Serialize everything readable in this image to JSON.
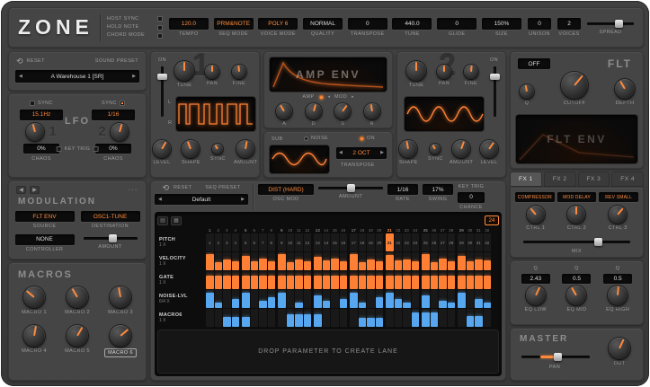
{
  "colors": {
    "accent": "#ff8a3c",
    "blue": "#56a7ef",
    "panel": "#454545",
    "display_bg": "#0c0c0c"
  },
  "header": {
    "logo": "ZONE",
    "toggles": [
      "HOST SYNC",
      "HOLD NOTE",
      "CHORD MODE"
    ],
    "fields": [
      {
        "label": "TEMPO",
        "value": "120.0",
        "accent": true
      },
      {
        "label": "SEQ MODE",
        "value": "PRM&NOTE",
        "accent": true
      },
      {
        "label": "VOICE MODE",
        "value": "POLY 6",
        "accent": true
      },
      {
        "label": "QUALITY",
        "value": "NORMAL",
        "accent": false
      },
      {
        "label": "TRANSPOSE",
        "value": "0",
        "accent": false
      },
      {
        "label": "TUNE",
        "value": "440.0",
        "accent": false
      },
      {
        "label": "GLIDE",
        "value": "0",
        "accent": false
      },
      {
        "label": "SIZE",
        "value": "150%",
        "accent": false
      }
    ],
    "unison": {
      "label": "UNISON",
      "value": "0"
    },
    "voices": {
      "label": "VOICES",
      "value": "2"
    },
    "spread_label": "SPREAD"
  },
  "preset": {
    "reset": "RESET",
    "label": "SOUND PRESET",
    "value": "A Warehouse 1 [SR]"
  },
  "lfo": {
    "title": "LFO",
    "key_trig": "KEY TRIG",
    "lfo1": {
      "num": "1",
      "sync": "SYNC",
      "rate": "15.1Hz",
      "chaos_value": "0%",
      "chaos": "CHAOS"
    },
    "lfo2": {
      "num": "2",
      "sync": "SYNC",
      "rate": "1/16",
      "chaos_value": "0%",
      "chaos": "CHAOS"
    }
  },
  "osc1": {
    "num": "1",
    "on": "ON",
    "tune": "TUNE",
    "pan": "PAN",
    "fine": "FINE",
    "left": "L",
    "right": "R",
    "level": "LEVEL",
    "shape": "SHAPE",
    "sync": "SYNC",
    "amount": "AMOUNT"
  },
  "osc2": {
    "num": "2",
    "on": "ON",
    "tune": "TUNE",
    "pan": "PAN",
    "fine": "FINE",
    "shape": "SHAPE",
    "sync": "SYNC",
    "amount": "AMOUNT",
    "level": "LEVEL"
  },
  "amp_env": {
    "title": "AMP ENV",
    "amp": "AMP",
    "mod": "MOD",
    "knobs": [
      "A",
      "D",
      "S",
      "R"
    ]
  },
  "sub": {
    "label": "SUB",
    "noise": "NOISE",
    "on": "ON",
    "transpose_value": "2 OCT",
    "transpose_label": "TRANSPOSE"
  },
  "filter": {
    "mode": "OFF",
    "title": "FLT",
    "knobs": [
      "Q",
      "CUTOFF",
      "DEPTH"
    ],
    "env_title": "FLT ENV"
  },
  "fx": {
    "tabs": [
      "FX 1",
      "FX 2",
      "FX 3",
      "FX 4"
    ],
    "active_tab": "FX 1",
    "slots": [
      "COMPRESSOR",
      "MOD DELAY",
      "REV SMALL"
    ],
    "ctrls": [
      "CTRL 1",
      "CTRL 2",
      "CTRL 3"
    ],
    "mix_label": "MIX"
  },
  "modulation": {
    "title": "MODULATION",
    "source": {
      "value": "FLT ENV",
      "label": "SOURCE"
    },
    "destination": {
      "value": "OSC1-TUNE",
      "label": "DESTINATION"
    },
    "controller": {
      "value": "NONE",
      "label": "CONTROLLER"
    },
    "amount_label": "AMOUNT"
  },
  "macros": {
    "title": "MACROS",
    "items": [
      "MACRO 1",
      "MACRO 2",
      "MACRO 3",
      "MACRO 4",
      "MACRO 5",
      "MACRO 6"
    ],
    "selected": "MACRO 6"
  },
  "eq": {
    "bands": [
      {
        "q_label": "Q",
        "q_value": "2.43",
        "label": "EQ LOW"
      },
      {
        "q_label": "Q",
        "q_value": "0.5",
        "label": "EQ MID"
      },
      {
        "q_label": "Q",
        "q_value": "0.5",
        "label": "EQ HIGH"
      }
    ]
  },
  "master": {
    "title": "MASTER",
    "pan_label": "PAN",
    "out_label": "OUT"
  },
  "sequencer": {
    "reset": "RESET",
    "preset_label": "SEQ PRESET",
    "preset_value": "Default",
    "osc_mod": {
      "value": "DIST (HARD)",
      "label": "OSC MOD"
    },
    "amount_label": "AMOUNT",
    "rate": {
      "value": "1/16",
      "label": "RATE"
    },
    "swing": {
      "value": "17%",
      "label": "SWING"
    },
    "key_trig": "KEY TRIG",
    "chance": {
      "value": "0",
      "label": "CHANCE"
    },
    "loop_value": "24",
    "steps": 32,
    "playhead": 21,
    "drop_text": "DROP PARAMETER TO CREATE LANE",
    "lanes": [
      {
        "name": "PITCH",
        "mult": "1 X",
        "type": "numbers",
        "values": [
          1,
          2,
          3,
          4,
          5,
          6,
          7,
          8,
          9,
          10,
          11,
          12,
          13,
          14,
          15,
          16,
          17,
          18,
          19,
          20,
          21,
          22,
          23,
          24,
          25,
          26,
          27,
          28,
          29,
          30,
          31,
          32
        ]
      },
      {
        "name": "VELOCITY",
        "mult": "1 X",
        "type": "bars",
        "color": "orange",
        "values": [
          0.9,
          0.45,
          0.6,
          0.5,
          0.8,
          0.5,
          0.65,
          0.5,
          0.9,
          0.45,
          0.6,
          0.5,
          0.75,
          0.55,
          0.65,
          0.5,
          0.9,
          0.45,
          0.6,
          0.5,
          0.85,
          0.55,
          0.6,
          0.5,
          0.9,
          0.45,
          0.65,
          0.5,
          0.8,
          0.5,
          0.6,
          0.55
        ]
      },
      {
        "name": "GATE",
        "mult": "1 X",
        "type": "bars",
        "color": "orange",
        "values": [
          0.75,
          0.75,
          0.75,
          0.75,
          0.75,
          0.75,
          0.75,
          0.75,
          0.75,
          0.75,
          0.75,
          0.75,
          0.75,
          0.75,
          0.75,
          0.75,
          0.75,
          0.75,
          0.75,
          0.75,
          0.75,
          0.75,
          0.75,
          0.75,
          0.75,
          0.75,
          0.75,
          0.75,
          0.75,
          0.75,
          0.75,
          0.75
        ]
      },
      {
        "name": "NOISE-LVL",
        "mult": "6/4 X",
        "type": "bars",
        "color": "blue",
        "values": [
          0.85,
          0.3,
          0,
          0.5,
          0.85,
          0,
          0.4,
          0.6,
          0.85,
          0,
          0.3,
          0,
          0.7,
          0.4,
          0,
          0.5,
          0.85,
          0.3,
          0,
          0.6,
          0.85,
          0.5,
          0.3,
          0,
          0.7,
          0,
          0.4,
          0.3,
          0.85,
          0,
          0.5,
          0.3
        ]
      },
      {
        "name": "MACRO6",
        "mult": "1 X",
        "type": "bars",
        "color": "blue",
        "values": [
          0,
          0,
          0.55,
          0.55,
          0.55,
          0,
          0,
          0,
          0,
          0.7,
          0.7,
          0.7,
          0.7,
          0,
          0,
          0,
          0,
          0.5,
          0.5,
          0.5,
          0,
          0,
          0,
          0.8,
          0.8,
          0.8,
          0,
          0,
          0,
          0.6,
          0.6,
          0
        ]
      }
    ]
  }
}
